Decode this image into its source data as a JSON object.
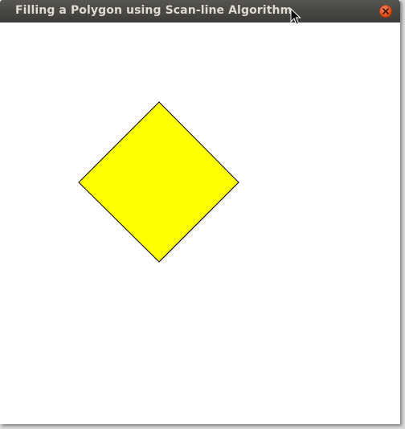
{
  "window": {
    "title": "Filling a Polygon using Scan-line Algorithm"
  },
  "icons": {
    "close": "close-icon",
    "cursor": "mouse-pointer-icon"
  },
  "polygon": {
    "fill_color": "#ffff00",
    "outline_color": "#000000"
  },
  "colors": {
    "titlebar": "#3c3b37",
    "title_text": "#dfdbd2",
    "close_button": "#df4a16",
    "canvas_background": "#ffffff"
  }
}
